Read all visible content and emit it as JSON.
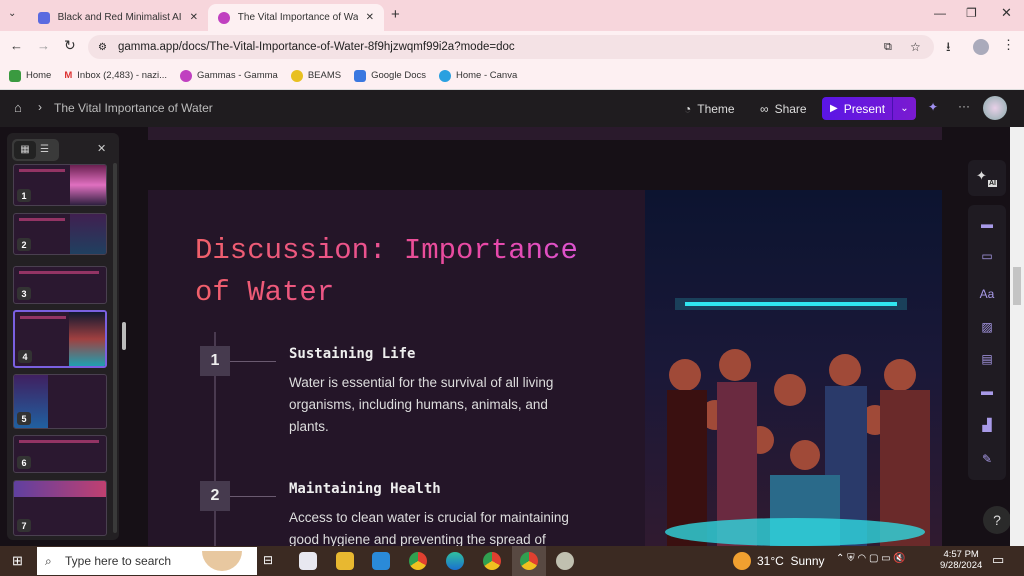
{
  "browser": {
    "tabs": [
      {
        "label": "Black and Red Minimalist AI We",
        "active": false
      },
      {
        "label": "The Vital Importance of Water |",
        "active": true
      }
    ],
    "url": "gamma.app/docs/The-Vital-Importance-of-Water-8f9hjzwqmf99i2a?mode=doc",
    "bookmarks": [
      "Home",
      "Inbox (2,483) - nazi...",
      "Gammas - Gamma",
      "BEAMS",
      "Google Docs",
      "Home - Canva"
    ]
  },
  "header": {
    "breadcrumb": "The Vital Importance of Water",
    "theme": "Theme",
    "share": "Share",
    "present": "Present"
  },
  "slide": {
    "title": "Discussion: Importance of Water",
    "items": [
      {
        "num": "1",
        "heading": "Sustaining Life",
        "body": "Water is essential for the survival of all living organisms, including humans, animals, and plants."
      },
      {
        "num": "2",
        "heading": "Maintaining Health",
        "body": "Access to clean water is crucial for maintaining good hygiene and preventing the spread of"
      }
    ]
  },
  "sidebar": {
    "thumbnails": [
      "1",
      "2",
      "3",
      "4",
      "5",
      "6",
      "7"
    ],
    "selected": "4"
  },
  "tools": {
    "ai_label": "AI",
    "text_label": "Aa",
    "help": "?"
  },
  "taskbar": {
    "search_placeholder": "Type here to search",
    "weather": "31°C  Sunny",
    "time": "4:57 PM",
    "date": "9/28/2024"
  },
  "colors": {
    "accent": "#6a18e0",
    "title_start": "#f0606a",
    "title_end": "#d858e0"
  }
}
